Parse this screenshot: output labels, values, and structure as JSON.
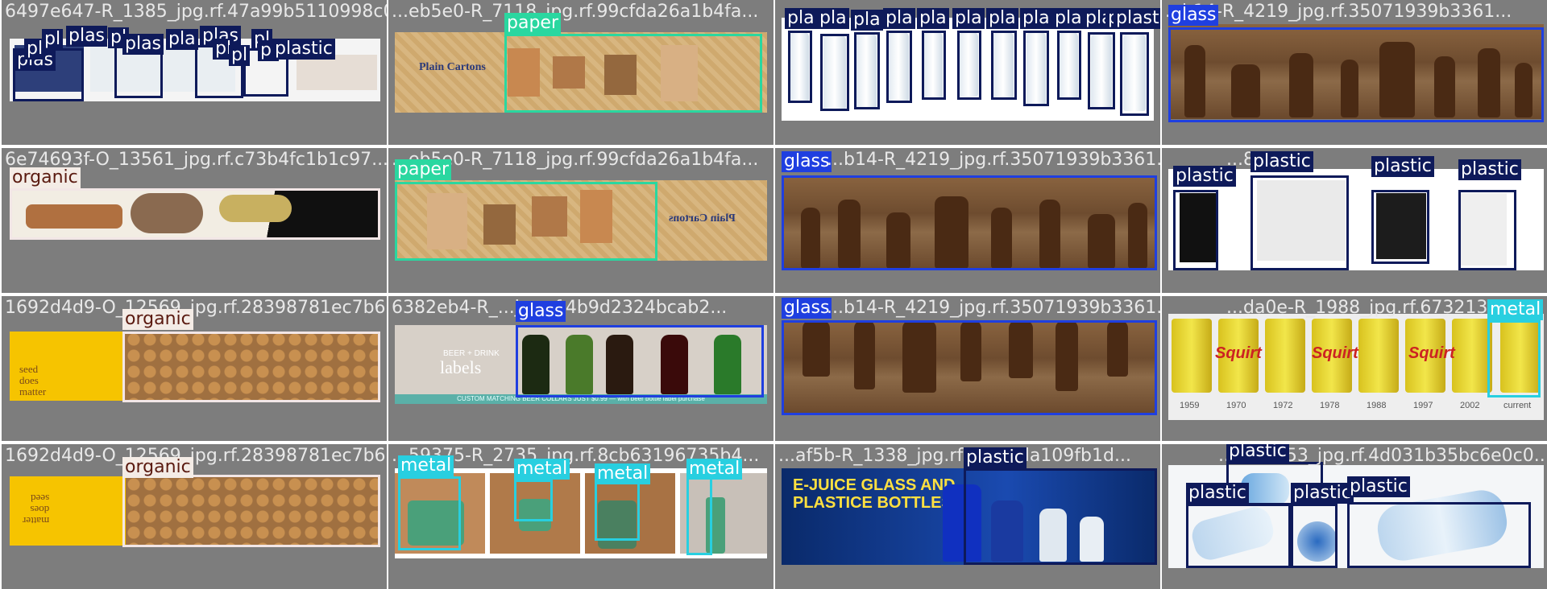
{
  "tiles": [
    {
      "file": "6497e647-R_1385_jpg.rf.47a99b5110998c035",
      "labels": [
        "plas",
        "pl",
        "pl",
        "plas",
        "pl",
        "plas",
        "pla",
        "plas",
        "pl",
        "pl",
        "pl",
        "pl",
        "plastic"
      ]
    },
    {
      "file": "...eb5e0-R_7118_jpg.rf.99cfda26a1b4fa...",
      "labels": [
        "paper"
      ],
      "image_text": "Plain Cartons"
    },
    {
      "file": "",
      "labels": [
        "pla",
        "pla",
        "pla",
        "pla",
        "pla",
        "pla",
        "pla",
        "pla",
        "pla",
        "pla",
        "pla",
        "plasti"
      ]
    },
    {
      "file": "...b14-R_4219_jpg.rf.35071939b3361...",
      "labels": [
        "glass"
      ]
    },
    {
      "file": "6e74693f-O_13561_jpg.rf.c73b4fc1b1c97...",
      "labels": [
        "organic"
      ]
    },
    {
      "file": "...eb5e0-R_7118_jpg.rf.99cfda26a1b4fa...",
      "labels": [
        "paper"
      ],
      "image_text": "Plain Cartons"
    },
    {
      "file": "...b14-R_4219_jpg.rf.35071939b3361...",
      "labels": [
        "glass"
      ]
    },
    {
      "file": "...88...7",
      "labels": [
        "plastic",
        "plastic",
        "plastic",
        "plastic"
      ]
    },
    {
      "file": "1692d4d9-O_12569_jpg.rf.28398781ec7b6...",
      "labels": [
        "organic"
      ],
      "image_text": [
        "seed",
        "does",
        "matter"
      ]
    },
    {
      "file": "6382eb4-R_...jpg.rf.4b9d2324bcab2...",
      "labels": [
        "glass"
      ],
      "image_text": [
        "BEER + DRINK",
        "labels",
        "CUSTOM MATCHING BEER COLLARS JUST $0.99 — with beer bottle label purchase"
      ]
    },
    {
      "file": "...b14-R_4219_jpg.rf.35071939b3361...",
      "labels": [
        "glass"
      ]
    },
    {
      "file": "...da0e-R_1988_jpg.rf.6732136...",
      "labels": [
        "metal"
      ],
      "image_text": [
        "Squirt",
        "1959",
        "1970",
        "1972",
        "1978",
        "1988",
        "1997",
        "2002",
        "current"
      ]
    },
    {
      "file": "1692d4d9-O_12569_jpg.rf.28398781ec7b6...",
      "labels": [
        "organic"
      ]
    },
    {
      "file": "...59375-R_2735_jpg.rf.8cb63196735b4...",
      "labels": [
        "metal",
        "metal",
        "metal",
        "metal"
      ]
    },
    {
      "file": "...af5b-R_1338_jpg.rf...3fe1da109fb1d...",
      "labels": [
        "plastic"
      ],
      "image_text": [
        "E-JUICE GLASS AND",
        "PLASTICE BOTTLES"
      ]
    },
    {
      "file": "...55d...53_jpg.rf.4d031b35bc6e0c0...",
      "labels": [
        "plastic",
        "plastic",
        "plastic",
        "plastic"
      ]
    }
  ],
  "colors": {
    "plastic": "#0e1a5a",
    "glass": "#1f3fe0",
    "paper": "#2ad7a0",
    "metal": "#28cfe0",
    "organic": "#f4ece6",
    "background": "#7d7d7d"
  }
}
